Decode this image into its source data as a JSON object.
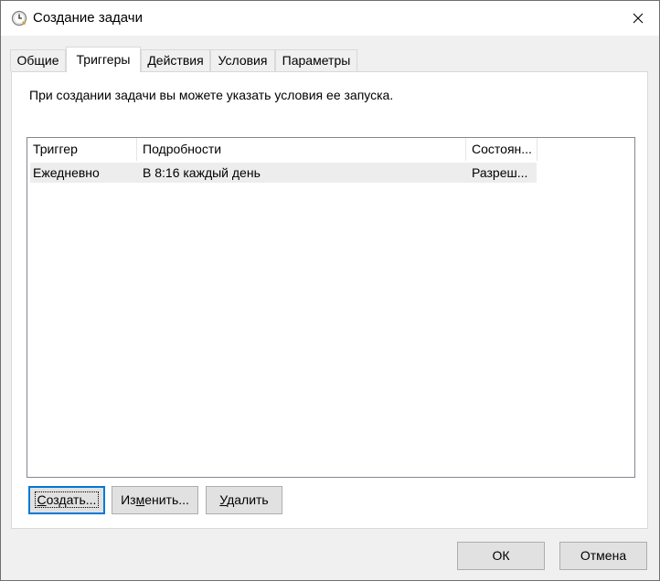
{
  "window": {
    "title": "Создание задачи",
    "icon": "clock-icon"
  },
  "tabs": [
    {
      "label": "Общие",
      "active": false
    },
    {
      "label": "Триггеры",
      "active": true
    },
    {
      "label": "Действия",
      "active": false
    },
    {
      "label": "Условия",
      "active": false
    },
    {
      "label": "Параметры",
      "active": false
    }
  ],
  "triggers_page": {
    "description": "При создании задачи вы можете указать условия ее запуска.",
    "columns": [
      "Триггер",
      "Подробности",
      "Состоян..."
    ],
    "rows": [
      {
        "trigger": "Ежедневно",
        "details": "В 8:16 каждый день",
        "state": "Разреш..."
      }
    ],
    "buttons": {
      "create": {
        "before": "",
        "underlined": "С",
        "after": "оздать..."
      },
      "edit": {
        "before": "Из",
        "underlined": "м",
        "after": "енить..."
      },
      "delete": {
        "before": "",
        "underlined": "У",
        "after": "далить"
      }
    }
  },
  "footer": {
    "ok_label": "ОК",
    "cancel_label": "Отмена"
  },
  "colors": {
    "window_bg": "#f0f0f0",
    "accent": "#0078d7",
    "row_highlight": "#ededed"
  }
}
